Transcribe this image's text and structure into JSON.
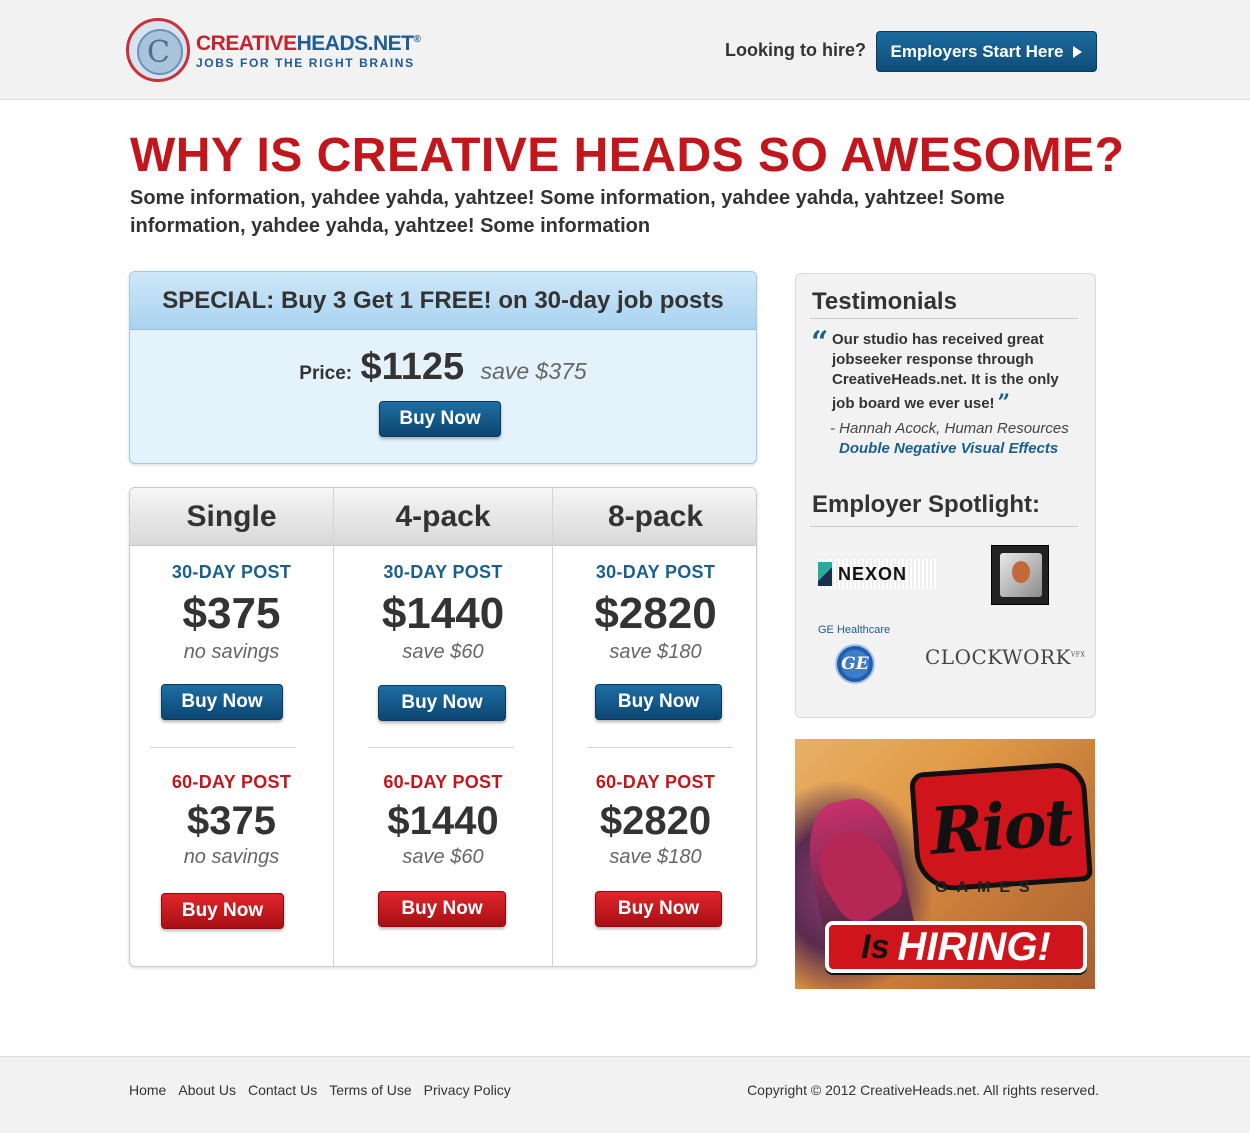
{
  "header": {
    "logo_name_red": "CREATIVE",
    "logo_name_blue": "HEADS.NET",
    "logo_registered": "®",
    "logo_tagline": "JOBS FOR THE RIGHT BRAINS",
    "hire_prompt": "Looking to hire?",
    "employers_button": "Employers Start Here"
  },
  "main": {
    "headline": "WHY IS CREATIVE HEADS SO AWESOME?",
    "intro": "Some information, yahdee yahda, yahtzee! Some information, yahdee yahda, yahtzee! Some information, yahdee yahda, yahtzee! Some information"
  },
  "special": {
    "title": "SPECIAL: Buy 3 Get 1 FREE! on 30-day job posts",
    "price_label": "Price:",
    "price": "$1125",
    "save": "save $375",
    "button": "Buy Now"
  },
  "pricing": {
    "columns": [
      {
        "name": "Single",
        "tiers": [
          {
            "label": "30-DAY POST",
            "price": "$375",
            "save": "no savings",
            "button": "Buy Now"
          },
          {
            "label": "60-DAY POST",
            "price": "$375",
            "save": "no savings",
            "button": "Buy Now"
          }
        ]
      },
      {
        "name": "4-pack",
        "tiers": [
          {
            "label": "30-DAY POST",
            "price": "$1440",
            "save": "save $60",
            "button": "Buy Now"
          },
          {
            "label": "60-DAY POST",
            "price": "$1440",
            "save": "save $60",
            "button": "Buy Now"
          }
        ]
      },
      {
        "name": "8-pack",
        "tiers": [
          {
            "label": "30-DAY POST",
            "price": "$2820",
            "save": "save $180",
            "button": "Buy Now"
          },
          {
            "label": "60-DAY POST",
            "price": "$2820",
            "save": "save $180",
            "button": "Buy Now"
          }
        ]
      }
    ]
  },
  "sidebar": {
    "testimonials_title": "Testimonials",
    "quote_open": "“",
    "quote_close": "”",
    "quote": "Our studio has received great jobseeker response through CreativeHeads.net. It is the only job board we ever use!",
    "author": "- Hannah Acock, Human Resources",
    "company": "Double Negative Visual Effects",
    "spotlight_title": "Employer Spotlight:",
    "spotlight": {
      "nexon": "NEXON",
      "ge_label": "GE Healthcare",
      "ge_mark": "GE",
      "clockwork": "CLOCKWORK",
      "clockwork_suffix": "VFX"
    }
  },
  "ad": {
    "brand": "Riot",
    "brand_sub": "GAMES",
    "is": "Is",
    "hiring": "HIRING!"
  },
  "footer": {
    "links": [
      "Home",
      "About Us",
      "Contact Us",
      "Terms of Use",
      "Privacy Policy"
    ],
    "copyright": "Copyright © 2012 CreativeHeads.net. All rights reserved."
  },
  "colors": {
    "brand_red": "#c1161c",
    "brand_blue": "#1a5f8e",
    "special_bg": "#e4f2fc"
  }
}
